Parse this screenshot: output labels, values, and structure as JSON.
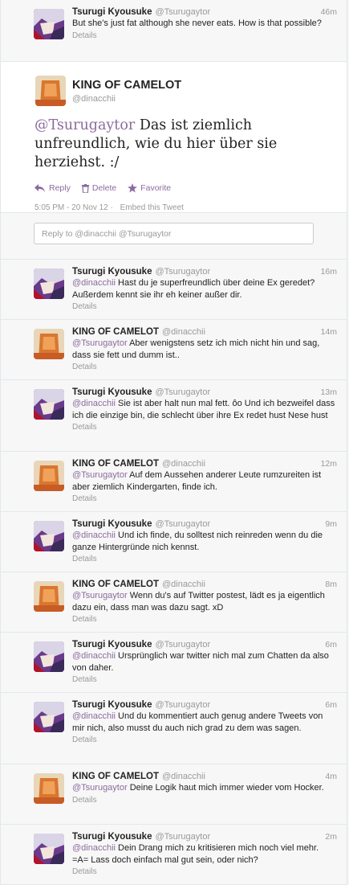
{
  "colors": {
    "mention": "#8c6b9d",
    "muted": "#999999",
    "background": "#f5f5f5"
  },
  "top_tweet": {
    "name": "Tsurugi Kyousuke",
    "handle": "@Tsurugaytor",
    "time": "46m",
    "text": "But she's just fat although she never eats. How is that possible?",
    "details": "Details"
  },
  "focus_tweet": {
    "name": "KING OF CAMELOT",
    "handle": "@dinacchii",
    "mention": "@Tsurugaytor",
    "text": " Das ist ziemlich unfreundlich, wie du hier über sie herziehst. :/",
    "actions": {
      "reply": "Reply",
      "delete": "Delete",
      "favorite": "Favorite"
    },
    "timestamp": "5:05 PM - 20 Nov 12",
    "separator": "·",
    "embed": "Embed this Tweet"
  },
  "reply_box": {
    "placeholder": "Reply to @dinacchii @Tsurugaytor"
  },
  "replies": [
    {
      "user": "tk",
      "name": "Tsurugi Kyousuke",
      "handle": "@Tsurugaytor",
      "time": "16m",
      "mention": "@dinacchii",
      "text": " Hast du je superfreundlich über deine Ex geredet? Außerdem kennt sie ihr eh keiner außer dir.",
      "details": "Details"
    },
    {
      "user": "kc",
      "name": "KING OF CAMELOT",
      "handle": "@dinacchii",
      "time": "14m",
      "mention": "@Tsurugaytor",
      "text": " Aber wenigstens setz ich mich nicht hin und sag, dass sie fett und dumm ist..",
      "details": "Details"
    },
    {
      "user": "tk",
      "name": "Tsurugi Kyousuke",
      "handle": "@Tsurugaytor",
      "time": "13m",
      "mention": "@dinacchii",
      "text": " Sie ist aber halt nun mal fett. ôo Und ich bezweifel dass ich die einzige bin, die schlecht über ihre Ex redet hust Nese hust",
      "details": "Details"
    },
    {
      "user": "kc",
      "name": "KING OF CAMELOT",
      "handle": "@dinacchii",
      "time": "12m",
      "mention": "@Tsurugaytor",
      "text": " Auf dem Aussehen anderer Leute rumzureiten ist aber ziemlich Kindergarten, finde ich.",
      "details": "Details"
    },
    {
      "user": "tk",
      "name": "Tsurugi Kyousuke",
      "handle": "@Tsurugaytor",
      "time": "9m",
      "mention": "@dinacchii",
      "text": " Und ich finde, du solltest nich reinreden wenn du die ganze Hintergründe nich kennst.",
      "details": "Details"
    },
    {
      "user": "kc",
      "name": "KING OF CAMELOT",
      "handle": "@dinacchii",
      "time": "8m",
      "mention": "@Tsurugaytor",
      "text": " Wenn du's auf Twitter postest, lädt es ja eigentlich dazu ein, dass man was dazu sagt. xD",
      "details": "Details"
    },
    {
      "user": "tk",
      "name": "Tsurugi Kyousuke",
      "handle": "@Tsurugaytor",
      "time": "6m",
      "mention": "@dinacchii",
      "text": " Ursprünglich war twitter nich mal zum Chatten da also von daher.",
      "details": "Details"
    },
    {
      "user": "tk",
      "name": "Tsurugi Kyousuke",
      "handle": "@Tsurugaytor",
      "time": "6m",
      "mention": "@dinacchii",
      "text": " Und du kommentiert auch genug andere Tweets von mir nich, also musst du auch nich grad zu dem was sagen.",
      "details": "Details"
    },
    {
      "user": "kc",
      "name": "KING OF CAMELOT",
      "handle": "@dinacchii",
      "time": "4m",
      "mention": "@Tsurugaytor",
      "text": " Deine Logik haut mich immer wieder vom Hocker.",
      "details": "Details"
    },
    {
      "user": "tk",
      "name": "Tsurugi Kyousuke",
      "handle": "@Tsurugaytor",
      "time": "2m",
      "mention": "@dinacchii",
      "text": " Dein Drang mich zu kritisieren mich noch viel mehr. =A= Lass doch einfach mal gut sein, oder nich?",
      "details": "Details"
    }
  ]
}
